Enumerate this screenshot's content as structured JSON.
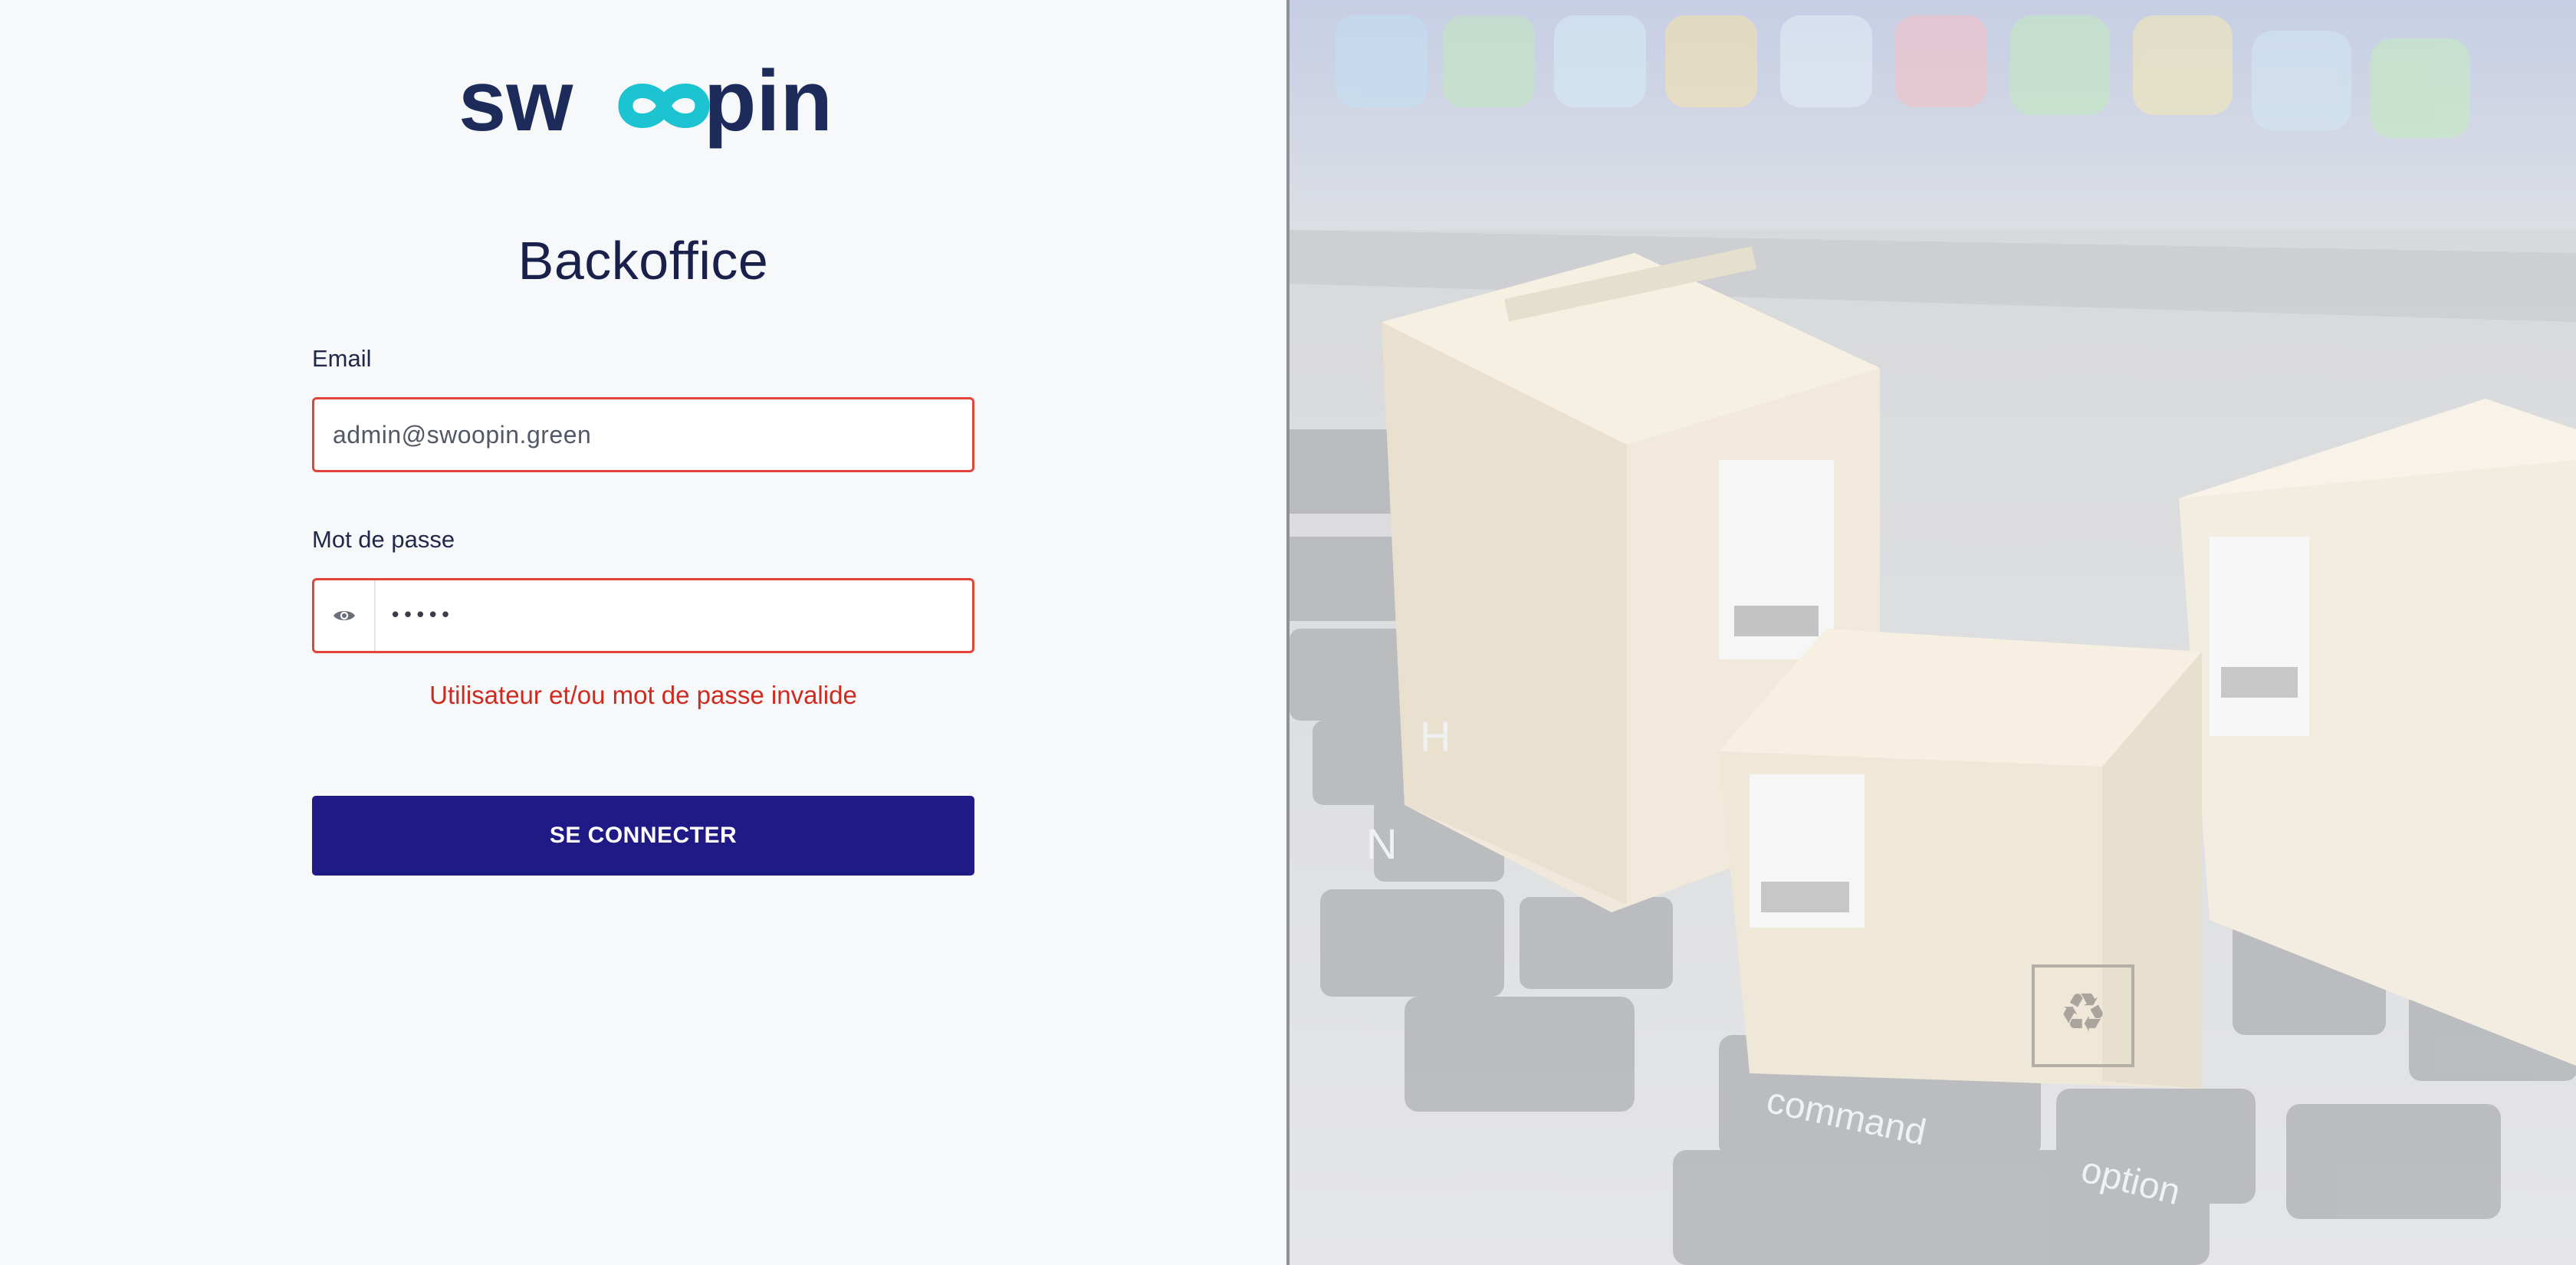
{
  "brand": {
    "logo_text": "swoopin",
    "colors": {
      "primary_dark": "#1c2b5a",
      "accent_teal": "#1cc4d2"
    }
  },
  "login": {
    "title": "Backoffice",
    "email": {
      "label": "Email",
      "value": "admin@swoopin.green"
    },
    "password": {
      "label": "Mot de passe",
      "value": "•••••",
      "toggle_icon": "eye-icon"
    },
    "error_message": "Utilisateur et/ou mot de passe invalide",
    "submit_label": "SE CONNECTER"
  },
  "colors": {
    "error": "#d02a1f",
    "error_border": "#e0443a",
    "button": "#1f1a85",
    "panel_background": "#f7f8fa"
  },
  "hero": {
    "image": "packages-on-laptop-keyboard",
    "key_labels": [
      "command",
      "option",
      "N",
      "H"
    ]
  }
}
